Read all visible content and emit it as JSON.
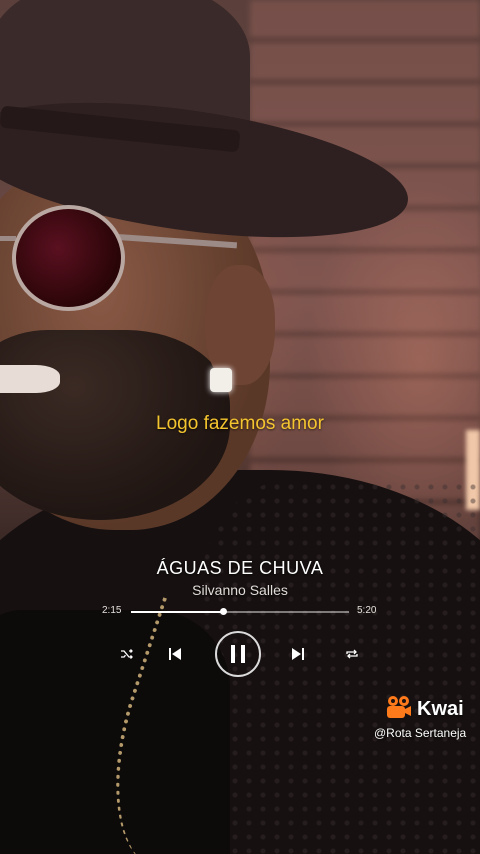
{
  "lyric": "Logo fazemos amor",
  "player": {
    "title": "ÁGUAS DE CHUVA",
    "artist": "Silvanno Salles",
    "elapsed": "2:15",
    "duration": "5:20",
    "progress": 0.42,
    "controls": {
      "shuffle_icon": "shuffle-icon",
      "previous_icon": "skip-previous-icon",
      "pause_icon": "pause-icon",
      "next_icon": "skip-next-icon",
      "repeat_icon": "repeat-icon"
    }
  },
  "watermark": {
    "brand": "Kwai",
    "handle": "@Rota Sertaneja",
    "brand_color": "#ff7a1a"
  },
  "colors": {
    "lyric": "#f4c52f"
  }
}
